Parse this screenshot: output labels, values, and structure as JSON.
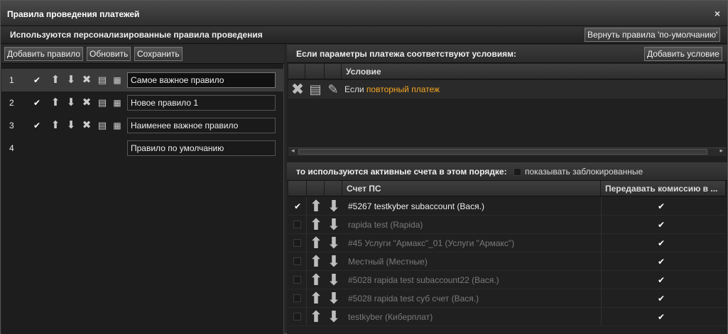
{
  "window": {
    "title": "Правила проведения платежей",
    "close": "×"
  },
  "subbar": {
    "title": "Используются персонализированные правила проведения",
    "reset_button": "Вернуть правила 'по-умолчанию'"
  },
  "left_toolbar": {
    "add": "Добавить правило",
    "refresh": "Обновить",
    "save": "Сохранить"
  },
  "rules": [
    {
      "num": "1",
      "name": "Самое важное правило",
      "checked": true,
      "selected": true,
      "has_icons": true
    },
    {
      "num": "2",
      "name": "Новое правило 1",
      "checked": true,
      "selected": false,
      "has_icons": true
    },
    {
      "num": "3",
      "name": "Наименее важное правило",
      "checked": true,
      "selected": false,
      "has_icons": true
    },
    {
      "num": "4",
      "name": "Правило по умолчанию",
      "checked": false,
      "selected": false,
      "has_icons": false
    }
  ],
  "conditions": {
    "header": "Если параметры платежа соответствуют условиям:",
    "add_button": "Добавить условие",
    "column": "Условие",
    "rows": [
      {
        "prefix": "Если",
        "link": "повторный платеж"
      }
    ]
  },
  "accounts": {
    "header": "то используются активные счета в этом порядке:",
    "show_blocked_label": "показывать заблокированные",
    "col_account": "Счет ПС",
    "col_commission": "Передавать комиссию в ...",
    "rows": [
      {
        "name": "#5267 testkyber subaccount (Вася.)",
        "active": true,
        "commission": true
      },
      {
        "name": "rapida test (Rapida)",
        "active": false,
        "commission": true
      },
      {
        "name": "#45 Услуги \"Армакс\"_01 (Услуги \"Армакс\")",
        "active": false,
        "commission": true
      },
      {
        "name": "Местный (Местные)",
        "active": false,
        "commission": true
      },
      {
        "name": "#5028 rapida test subaccount22 (Вася.)",
        "active": false,
        "commission": true
      },
      {
        "name": "#5028 rapida test суб счет (Вася.)",
        "active": false,
        "commission": true
      },
      {
        "name": "testkyber (Киберплат)",
        "active": false,
        "commission": true
      }
    ]
  }
}
